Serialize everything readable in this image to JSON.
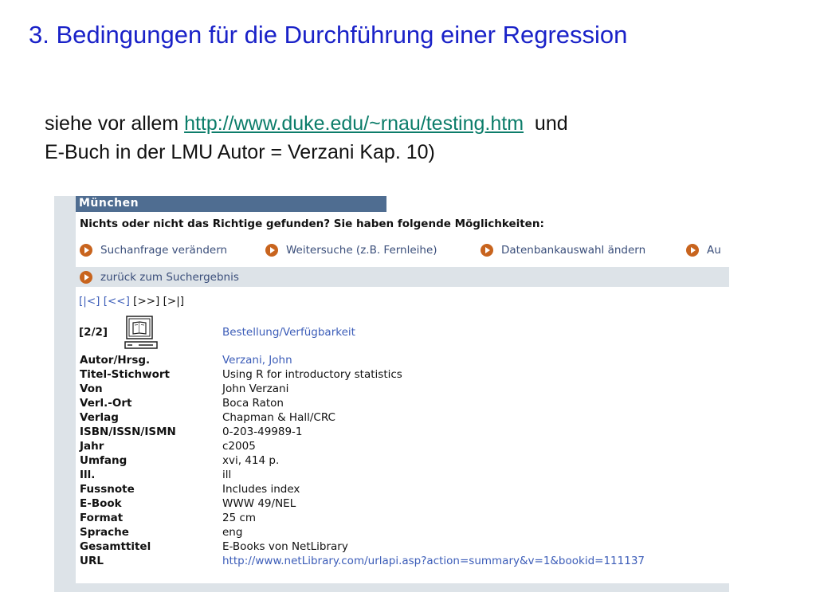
{
  "slide": {
    "title": "3. Bedingungen für die Durchführung einer Regression",
    "intro_before": "siehe vor allem ",
    "intro_link": "http://www.duke.edu/~rnau/testing.htm",
    "intro_after": "  und",
    "intro_line2": "E-Buch in der LMU Autor = Verzani Kap. 10)"
  },
  "colors": {
    "title": "#1a22c8",
    "link": "#0c7d6a",
    "header_bar": "#4f6d91",
    "bullet": "#c8641e",
    "opac_link": "#3b5cb8"
  },
  "opac": {
    "header": "München",
    "headline": "Nichts oder nicht das Richtige gefunden? Sie haben folgende Möglichkeiten:",
    "options": [
      {
        "label": "Suchanfrage verändern",
        "icon": "arrow-bullet-icon"
      },
      {
        "label": "Weitersuche (z.B. Fernleihe)",
        "icon": "arrow-bullet-icon"
      },
      {
        "label": "Datenbankauswahl ändern",
        "icon": "arrow-bullet-icon"
      },
      {
        "label": "Au",
        "icon": "arrow-bullet-icon"
      }
    ],
    "back": "zurück zum Suchergebnis",
    "pager": {
      "first": "[|<]",
      "prev": "[<<]",
      "next": "[>>]",
      "last": "[>|]"
    },
    "record_count": "[2/2]",
    "record_icon": "book-terminal-icon",
    "order_link": "Bestellung/Verfügbarkeit",
    "fields": [
      {
        "label": "Autor/Hrsg.",
        "value": "Verzani, John",
        "link": true
      },
      {
        "label": "Titel-Stichwort",
        "value": "Using R for introductory statistics",
        "link": false
      },
      {
        "label": "Von",
        "value": "John Verzani",
        "link": false
      },
      {
        "label": "Verl.-Ort",
        "value": "Boca Raton",
        "link": false
      },
      {
        "label": "Verlag",
        "value": "Chapman & Hall/CRC",
        "link": false
      },
      {
        "label": "ISBN/ISSN/ISMN",
        "value": "0-203-49989-1",
        "link": false
      },
      {
        "label": "Jahr",
        "value": "c2005",
        "link": false
      },
      {
        "label": "Umfang",
        "value": "xvi, 414 p.",
        "link": false
      },
      {
        "label": "Ill.",
        "value": "ill",
        "link": false
      },
      {
        "label": "Fussnote",
        "value": "Includes index",
        "link": false
      },
      {
        "label": "E-Book",
        "value": "WWW 49/NEL",
        "link": false
      },
      {
        "label": "Format",
        "value": "25 cm",
        "link": false
      },
      {
        "label": "Sprache",
        "value": "eng",
        "link": false
      },
      {
        "label": "Gesamttitel",
        "value": "E-Books von NetLibrary",
        "link": false
      },
      {
        "label": "URL",
        "value": "http://www.netLibrary.com/urlapi.asp?action=summary&v=1&bookid=111137",
        "link": true
      }
    ]
  }
}
